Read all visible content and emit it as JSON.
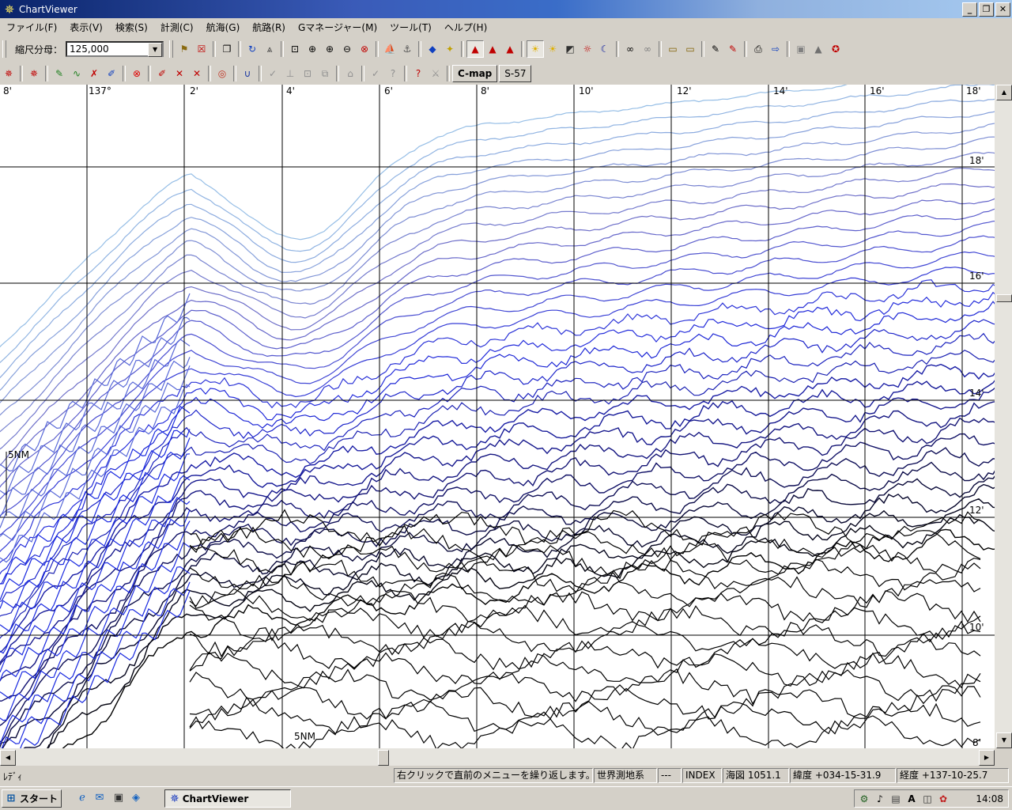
{
  "window": {
    "title": "ChartViewer",
    "buttons": [
      "_",
      "❐",
      "✕"
    ]
  },
  "menu": [
    "ファイル(F)",
    "表示(V)",
    "検索(S)",
    "計測(C)",
    "航海(G)",
    "航路(R)",
    "Gマネージャー(M)",
    "ツール(T)",
    "ヘルプ(H)"
  ],
  "toolbar": {
    "scale_label": "縮尺分母：",
    "scale_value": "125,000",
    "cmap_label": "C-map",
    "s57_label": "S-57"
  },
  "chart": {
    "top_labels": [
      "8'",
      "137°",
      "2'",
      "4'",
      "6'",
      "8'",
      "10'",
      "12'",
      "14'",
      "16'",
      "18'"
    ],
    "right_labels": [
      "18'",
      "16'",
      "14'",
      "12'",
      "10'",
      "8'"
    ],
    "scale_bar": "5NM",
    "scale_bar_2": "5NM"
  },
  "status": {
    "ready": "ﾚﾃﾞｨ",
    "hint": "右クリックで直前のメニューを繰り返します。",
    "datum": "世界測地系",
    "dash": "---",
    "index": "INDEX",
    "chart_no": "海図 1051.1",
    "lat": "緯度 +034-15-31.9",
    "lon": "経度 +137-10-25.7"
  },
  "taskbar": {
    "start": "スタート",
    "task": "ChartViewer",
    "clock": "14:08",
    "tray_text": "A"
  }
}
